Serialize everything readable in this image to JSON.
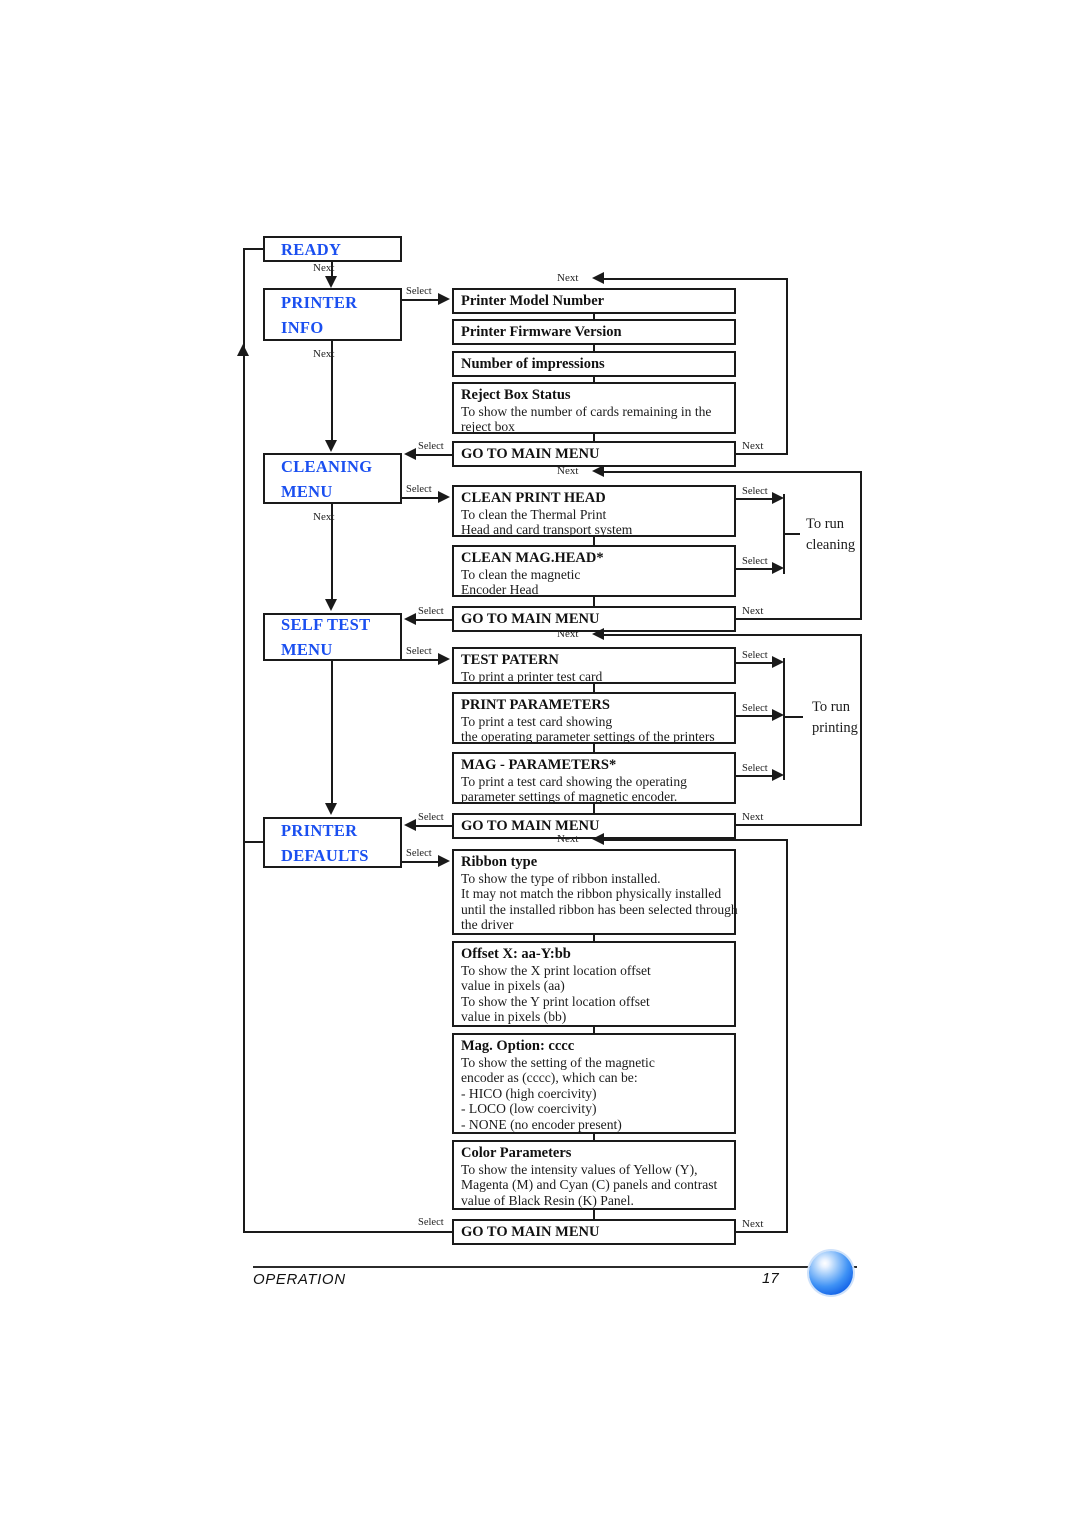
{
  "document": {
    "footer_section": "OPERATION",
    "footer_page": "17",
    "footer_orb_icon": "blue-sphere-icon"
  },
  "edge_labels": {
    "next": "Next",
    "select": "Select"
  },
  "menu_states": [
    {
      "id": "ready",
      "lines": [
        "READY"
      ]
    },
    {
      "id": "printer-info",
      "lines": [
        "PRINTER",
        "INFO"
      ]
    },
    {
      "id": "cleaning-menu",
      "lines": [
        "CLEANING",
        "MENU"
      ]
    },
    {
      "id": "self-test-menu",
      "lines": [
        "SELF TEST",
        "MENU"
      ]
    },
    {
      "id": "printer-defaults",
      "lines": [
        "PRINTER",
        "DEFAULTS"
      ]
    }
  ],
  "printer_info_items": [
    {
      "title": "Printer Model Number",
      "desc": []
    },
    {
      "title": "Printer Firmware Version",
      "desc": []
    },
    {
      "title": "Number of impressions",
      "desc": []
    },
    {
      "title": "Reject Box Status",
      "desc": [
        "To show the number of cards remaining in the",
        "reject box"
      ]
    },
    {
      "title": "GO TO MAIN MENU",
      "desc": []
    }
  ],
  "cleaning_items": [
    {
      "title": "CLEAN PRINT HEAD",
      "desc": [
        "To clean the Thermal Print",
        "Head and card transport system"
      ]
    },
    {
      "title": "CLEAN MAG.HEAD*",
      "desc": [
        "To clean the magnetic",
        "Encoder Head"
      ]
    },
    {
      "title": "GO TO MAIN MENU",
      "desc": []
    }
  ],
  "self_test_items": [
    {
      "title": "TEST PATERN",
      "desc": [
        "To print a printer test card"
      ]
    },
    {
      "title": "PRINT PARAMETERS",
      "desc": [
        "To print a test card showing",
        "the operating parameter settings of the printers"
      ]
    },
    {
      "title": "MAG - PARAMETERS*",
      "desc": [
        "To print a test card showing the operating",
        "parameter settings of magnetic encoder."
      ]
    },
    {
      "title": "GO TO MAIN MENU",
      "desc": []
    }
  ],
  "printer_defaults_items": [
    {
      "title": "Ribbon type",
      "desc": [
        "To show the type of ribbon installed.",
        "It may not match the ribbon physically installed",
        "until the installed ribbon has been selected through",
        "the driver"
      ]
    },
    {
      "title": "Offset X: aa-Y:bb",
      "desc": [
        "To show the X print location offset",
        "value in pixels (aa)",
        "To show the Y print location offset",
        "value in pixels (bb)"
      ]
    },
    {
      "title": "Mag. Option: cccc",
      "desc": [
        "To show the setting of the magnetic",
        "encoder as (cccc), which can be:",
        "- HICO (high coercivity)",
        "- LOCO (low coercivity)",
        "- NONE (no encoder present)"
      ]
    },
    {
      "title": "Color Parameters",
      "desc": [
        "To show the intensity values of Yellow (Y),",
        "Magenta (M) and Cyan (C) panels and contrast",
        "value of Black Resin (K) Panel."
      ]
    },
    {
      "title": "GO TO MAIN MENU",
      "desc": []
    }
  ],
  "annotations": {
    "cleaning_action": [
      "To run",
      "cleaning"
    ],
    "printing_action": [
      "To run",
      "printing"
    ]
  },
  "colors": {
    "state_text": "#1a4ff0",
    "line": "#1a1a1a",
    "orb": "#2f86f2"
  }
}
